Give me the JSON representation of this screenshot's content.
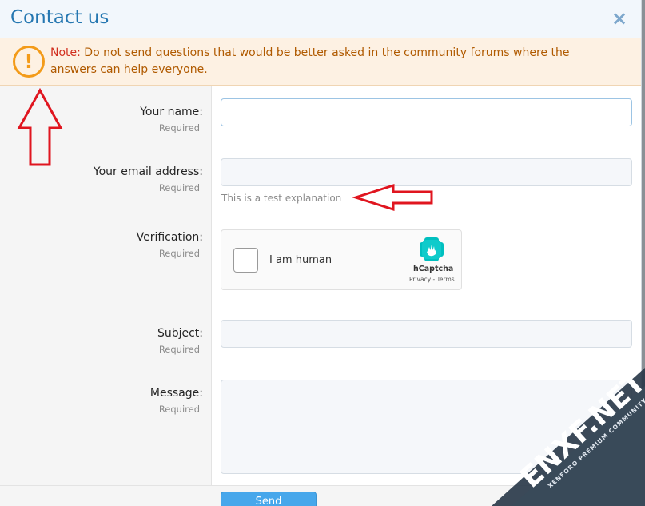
{
  "dialog": {
    "title": "Contact us",
    "close_icon": "×"
  },
  "notice": {
    "icon": "!",
    "label": "Note:",
    "text": " Do not send questions that would be better asked in the community forums where the answers can help everyone."
  },
  "form": {
    "name": {
      "label": "Your name:",
      "hint": "Required",
      "value": ""
    },
    "email": {
      "label": "Your email address:",
      "hint": "Required",
      "value": "",
      "explain": "This is a test explanation"
    },
    "verification": {
      "label": "Verification:",
      "hint": "Required"
    },
    "subject": {
      "label": "Subject:",
      "hint": "Required",
      "value": ""
    },
    "message": {
      "label": "Message:",
      "hint": "Required",
      "value": ""
    },
    "send_label": "Send"
  },
  "captcha": {
    "label": "I am human",
    "brand": "hCaptcha",
    "links": "Privacy - Terms",
    "logo_icon": "hcaptcha-hand-icon"
  },
  "watermark": {
    "main": "ENXF.NET",
    "sub": "XENFORO PREMIUM COMMUNITY"
  },
  "colors": {
    "title": "#2577b1",
    "note_label": "#d12e1e",
    "notice_text": "#b05a00",
    "warning": "#f39b19",
    "annotation_arrow": "#e0151f",
    "send_button": "#47a7eb"
  }
}
